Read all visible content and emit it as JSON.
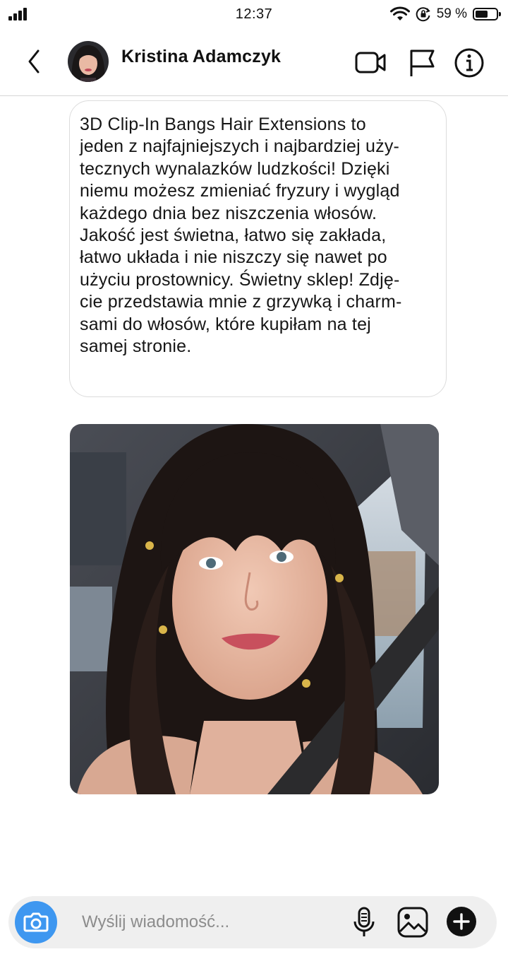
{
  "status_bar": {
    "time": "12:37",
    "battery_percent": "59 %",
    "battery_level": 0.59,
    "icons": [
      "cellular-signal-icon",
      "wifi-icon",
      "rotation-lock-icon",
      "battery-icon"
    ]
  },
  "header": {
    "contact_name": "Kristina Adamczyk",
    "icons": [
      "back-chevron-icon",
      "video-call-icon",
      "flag-icon",
      "info-icon"
    ]
  },
  "message": {
    "text_lines": [
      "3D Clip-In Bangs Hair Extensions to",
      "jeden z najfajniejszych i najbardziej uży-",
      "tecznych wynalazków ludzkości! Dzięki",
      "niemu możesz zmieniać fryzury i wygląd",
      "każdego dnia bez niszczenia włosów.",
      "Jakość jest świetna, łatwo się zakłada,",
      "łatwo układa i nie niszczy się nawet po",
      "użyciu prostownicy. Świetny sklep! Zdję-",
      "cie przedstawia mnie z grzywką i charm-",
      "sami do włosów, które kupiłam na tej",
      "samej stronie."
    ]
  },
  "composer": {
    "placeholder": "Wyślij wiadomość...",
    "icons": [
      "camera-icon",
      "microphone-icon",
      "gallery-icon",
      "plus-icon"
    ]
  },
  "colors": {
    "accent_blue": "#3e97f0",
    "text_dark": "#111111",
    "composer_bg": "#efefef",
    "bubble_border": "#dcdcdc",
    "placeholder_gray": "#8c8c8c"
  }
}
